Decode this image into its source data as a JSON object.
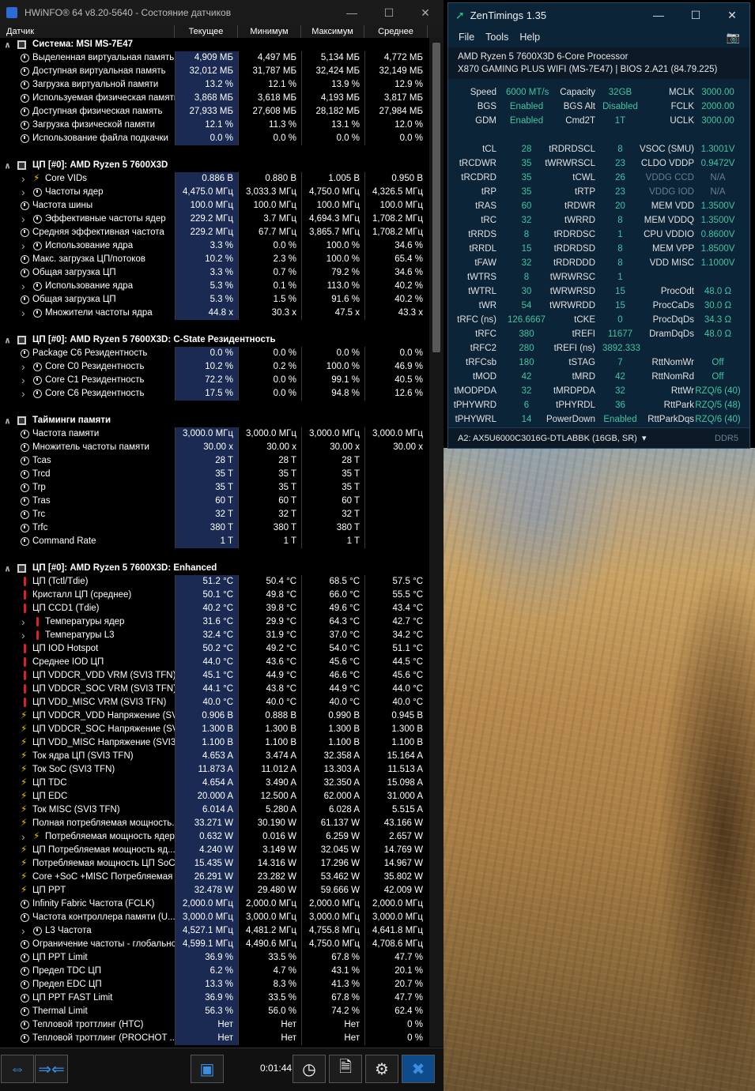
{
  "hwinfo": {
    "title": "HWiNFO® 64 v8.20-5640 - Состояние датчиков",
    "columns": [
      "Датчик",
      "Текущее",
      "Минимум",
      "Максимум",
      "Среднее"
    ],
    "rows": [
      {
        "t": "g",
        "n": "Система: MSI MS-7E47"
      },
      {
        "t": "r",
        "n": "Выделенная виртуальная память",
        "ic": "gauge",
        "v": [
          "4,909 МБ",
          "4,497 МБ",
          "5,134 МБ",
          "4,772 МБ"
        ]
      },
      {
        "t": "r",
        "n": "Доступная виртуальная память",
        "ic": "gauge",
        "v": [
          "32,012 МБ",
          "31,787 МБ",
          "32,424 МБ",
          "32,149 МБ"
        ]
      },
      {
        "t": "r",
        "n": "Загрузка виртуальной памяти",
        "ic": "gauge",
        "v": [
          "13.2 %",
          "12.1 %",
          "13.9 %",
          "12.9 %"
        ]
      },
      {
        "t": "r",
        "n": "Используемая физическая память",
        "ic": "gauge",
        "v": [
          "3,868 МБ",
          "3,618 МБ",
          "4,193 МБ",
          "3,817 МБ"
        ]
      },
      {
        "t": "r",
        "n": "Доступная физическая память",
        "ic": "gauge",
        "v": [
          "27,933 МБ",
          "27,608 МБ",
          "28,182 МБ",
          "27,984 МБ"
        ]
      },
      {
        "t": "r",
        "n": "Загрузка физической памяти",
        "ic": "gauge",
        "v": [
          "12.1 %",
          "11.3 %",
          "13.1 %",
          "12.0 %"
        ]
      },
      {
        "t": "r",
        "n": "Использование файла подкачки",
        "ic": "gauge",
        "v": [
          "0.0 %",
          "0.0 %",
          "0.0 %",
          "0.0 %"
        ]
      },
      {
        "t": "s"
      },
      {
        "t": "g",
        "n": "ЦП [#0]: AMD Ryzen 5 7600X3D"
      },
      {
        "t": "r",
        "n": "Core VIDs",
        "ic": "bolt",
        "sub": 1,
        "v": [
          "0.886 В",
          "0.880 В",
          "1.005 В",
          "0.950 В"
        ]
      },
      {
        "t": "r",
        "n": "Частоты ядер",
        "ic": "gauge",
        "sub": 1,
        "v": [
          "4,475.0 МГц",
          "3,033.3 МГц",
          "4,750.0 МГц",
          "4,326.5 МГц"
        ]
      },
      {
        "t": "r",
        "n": "Частота шины",
        "ic": "gauge",
        "v": [
          "100.0 МГц",
          "100.0 МГц",
          "100.0 МГц",
          "100.0 МГц"
        ]
      },
      {
        "t": "r",
        "n": "Эффективные частоты ядер",
        "ic": "gauge",
        "sub": 1,
        "v": [
          "229.2 МГц",
          "3.7 МГц",
          "4,694.3 МГц",
          "1,708.2 МГц"
        ]
      },
      {
        "t": "r",
        "n": "Средняя эффективная частота",
        "ic": "gauge",
        "v": [
          "229.2 МГц",
          "67.7 МГц",
          "3,865.7 МГц",
          "1,708.2 МГц"
        ]
      },
      {
        "t": "r",
        "n": "Использование ядра",
        "ic": "gauge",
        "sub": 1,
        "v": [
          "3.3 %",
          "0.0 %",
          "100.0 %",
          "34.6 %"
        ]
      },
      {
        "t": "r",
        "n": "Макс. загрузка ЦП/потоков",
        "ic": "gauge",
        "v": [
          "10.2 %",
          "2.3 %",
          "100.0 %",
          "65.4 %"
        ]
      },
      {
        "t": "r",
        "n": "Общая загрузка ЦП",
        "ic": "gauge",
        "v": [
          "3.3 %",
          "0.7 %",
          "79.2 %",
          "34.6 %"
        ]
      },
      {
        "t": "r",
        "n": "Использование ядра",
        "ic": "gauge",
        "sub": 1,
        "v": [
          "5.3 %",
          "0.1 %",
          "113.0 %",
          "40.2 %"
        ]
      },
      {
        "t": "r",
        "n": "Общая загрузка ЦП",
        "ic": "gauge",
        "v": [
          "5.3 %",
          "1.5 %",
          "91.6 %",
          "40.2 %"
        ]
      },
      {
        "t": "r",
        "n": "Множители частоты ядра",
        "ic": "gauge",
        "sub": 1,
        "v": [
          "44.8 x",
          "30.3 x",
          "47.5 x",
          "43.3 x"
        ]
      },
      {
        "t": "s"
      },
      {
        "t": "g",
        "n": "ЦП [#0]: AMD Ryzen 5 7600X3D: C-State Резидентность"
      },
      {
        "t": "r",
        "n": "Package C6 Резидентность",
        "ic": "gauge",
        "v": [
          "0.0 %",
          "0.0 %",
          "0.0 %",
          "0.0 %"
        ]
      },
      {
        "t": "r",
        "n": "Core C0 Резидентность",
        "ic": "gauge",
        "sub": 1,
        "v": [
          "10.2 %",
          "0.2 %",
          "100.0 %",
          "46.9 %"
        ]
      },
      {
        "t": "r",
        "n": "Core C1 Резидентность",
        "ic": "gauge",
        "sub": 1,
        "v": [
          "72.2 %",
          "0.0 %",
          "99.1 %",
          "40.5 %"
        ]
      },
      {
        "t": "r",
        "n": "Core C6 Резидентность",
        "ic": "gauge",
        "sub": 1,
        "v": [
          "17.5 %",
          "0.0 %",
          "94.8 %",
          "12.6 %"
        ]
      },
      {
        "t": "s"
      },
      {
        "t": "g",
        "n": "Тайминги памяти"
      },
      {
        "t": "r",
        "n": "Частота памяти",
        "ic": "gauge",
        "v": [
          "3,000.0 МГц",
          "3,000.0 МГц",
          "3,000.0 МГц",
          "3,000.0 МГц"
        ]
      },
      {
        "t": "r",
        "n": "Множитель частоты памяти",
        "ic": "gauge",
        "v": [
          "30.00 x",
          "30.00 x",
          "30.00 x",
          "30.00 x"
        ]
      },
      {
        "t": "r",
        "n": "Tcas",
        "ic": "gauge",
        "v": [
          "28 T",
          "28 T",
          "28 T",
          ""
        ]
      },
      {
        "t": "r",
        "n": "Trcd",
        "ic": "gauge",
        "v": [
          "35 T",
          "35 T",
          "35 T",
          ""
        ]
      },
      {
        "t": "r",
        "n": "Trp",
        "ic": "gauge",
        "v": [
          "35 T",
          "35 T",
          "35 T",
          ""
        ]
      },
      {
        "t": "r",
        "n": "Tras",
        "ic": "gauge",
        "v": [
          "60 T",
          "60 T",
          "60 T",
          ""
        ]
      },
      {
        "t": "r",
        "n": "Trc",
        "ic": "gauge",
        "v": [
          "32 T",
          "32 T",
          "32 T",
          ""
        ]
      },
      {
        "t": "r",
        "n": "Trfc",
        "ic": "gauge",
        "v": [
          "380 T",
          "380 T",
          "380 T",
          ""
        ]
      },
      {
        "t": "r",
        "n": "Command Rate",
        "ic": "gauge",
        "v": [
          "1 T",
          "1 T",
          "1 T",
          ""
        ]
      },
      {
        "t": "s"
      },
      {
        "t": "g",
        "n": "ЦП [#0]: AMD Ryzen 5 7600X3D: Enhanced"
      },
      {
        "t": "r",
        "n": "ЦП (Tctl/Tdie)",
        "ic": "th",
        "v": [
          "51.2 °C",
          "50.4 °C",
          "68.5 °C",
          "57.5 °C"
        ]
      },
      {
        "t": "r",
        "n": "Кристалл ЦП (среднее)",
        "ic": "th",
        "v": [
          "50.1 °C",
          "49.8 °C",
          "66.0 °C",
          "55.5 °C"
        ]
      },
      {
        "t": "r",
        "n": "ЦП CCD1 (Tdie)",
        "ic": "th",
        "v": [
          "40.2 °C",
          "39.8 °C",
          "49.6 °C",
          "43.4 °C"
        ]
      },
      {
        "t": "r",
        "n": "Температуры ядер",
        "ic": "th",
        "sub": 1,
        "v": [
          "31.6 °C",
          "29.9 °C",
          "64.3 °C",
          "42.7 °C"
        ]
      },
      {
        "t": "r",
        "n": "Температуры L3",
        "ic": "th",
        "sub": 1,
        "v": [
          "32.4 °C",
          "31.9 °C",
          "37.0 °C",
          "34.2 °C"
        ]
      },
      {
        "t": "r",
        "n": "ЦП IOD Hotspot",
        "ic": "th",
        "v": [
          "50.2 °C",
          "49.2 °C",
          "54.0 °C",
          "51.1 °C"
        ]
      },
      {
        "t": "r",
        "n": "Среднее IOD ЦП",
        "ic": "th",
        "v": [
          "44.0 °C",
          "43.6 °C",
          "45.6 °C",
          "44.5 °C"
        ]
      },
      {
        "t": "r",
        "n": "ЦП VDDCR_VDD VRM (SVI3 TFN)",
        "ic": "th",
        "v": [
          "45.1 °C",
          "44.9 °C",
          "46.6 °C",
          "45.6 °C"
        ]
      },
      {
        "t": "r",
        "n": "ЦП VDDCR_SOC VRM (SVI3 TFN)",
        "ic": "th",
        "v": [
          "44.1 °C",
          "43.8 °C",
          "44.9 °C",
          "44.0 °C"
        ]
      },
      {
        "t": "r",
        "n": "ЦП VDD_MISC VRM (SVI3 TFN)",
        "ic": "th",
        "v": [
          "40.0 °C",
          "40.0 °C",
          "40.0 °C",
          "40.0 °C"
        ]
      },
      {
        "t": "r",
        "n": "ЦП VDDCR_VDD Напряжение (SV...",
        "ic": "bolt",
        "v": [
          "0.906 В",
          "0.888 В",
          "0.990 В",
          "0.945 В"
        ]
      },
      {
        "t": "r",
        "n": "ЦП VDDCR_SOC Напряжение (SV...",
        "ic": "bolt",
        "v": [
          "1.300 В",
          "1.300 В",
          "1.300 В",
          "1.300 В"
        ]
      },
      {
        "t": "r",
        "n": "ЦП VDD_MISC Напряжение (SVI3...",
        "ic": "bolt",
        "v": [
          "1.100 В",
          "1.100 В",
          "1.100 В",
          "1.100 В"
        ]
      },
      {
        "t": "r",
        "n": "Ток ядра ЦП (SVI3 TFN)",
        "ic": "bolt",
        "v": [
          "4.653 A",
          "3.474 A",
          "32.358 A",
          "15.164 A"
        ]
      },
      {
        "t": "r",
        "n": "Ток SoC (SVI3 TFN)",
        "ic": "bolt",
        "v": [
          "11.873 A",
          "11.012 A",
          "13.303 A",
          "11.513 A"
        ]
      },
      {
        "t": "r",
        "n": "ЦП TDC",
        "ic": "bolt",
        "v": [
          "4.654 A",
          "3.490 A",
          "32.350 A",
          "15.098 A"
        ]
      },
      {
        "t": "r",
        "n": "ЦП EDC",
        "ic": "bolt",
        "v": [
          "20.000 A",
          "12.500 A",
          "62.000 A",
          "31.000 A"
        ]
      },
      {
        "t": "r",
        "n": "Ток MISC (SVI3 TFN)",
        "ic": "bolt",
        "v": [
          "6.014 A",
          "5.280 A",
          "6.028 A",
          "5.515 A"
        ]
      },
      {
        "t": "r",
        "n": "Полная потребляемая мощность...",
        "ic": "bolt",
        "v": [
          "33.271 W",
          "30.190 W",
          "61.137 W",
          "43.166 W"
        ]
      },
      {
        "t": "r",
        "n": "Потребляемая мощность ядер",
        "ic": "bolt",
        "sub": 1,
        "v": [
          "0.632 W",
          "0.016 W",
          "6.259 W",
          "2.657 W"
        ]
      },
      {
        "t": "r",
        "n": "ЦП Потребляемая мощность яд...",
        "ic": "bolt",
        "v": [
          "4.240 W",
          "3.149 W",
          "32.045 W",
          "14.769 W"
        ]
      },
      {
        "t": "r",
        "n": "Потребляемая мощность ЦП SoC",
        "ic": "bolt",
        "v": [
          "15.435 W",
          "14.316 W",
          "17.296 W",
          "14.967 W"
        ]
      },
      {
        "t": "r",
        "n": "Core +SoC +MISC Потребляемая ...",
        "ic": "bolt",
        "v": [
          "26.291 W",
          "23.282 W",
          "53.462 W",
          "35.802 W"
        ]
      },
      {
        "t": "r",
        "n": "ЦП PPT",
        "ic": "bolt",
        "v": [
          "32.478 W",
          "29.480 W",
          "59.666 W",
          "42.009 W"
        ]
      },
      {
        "t": "r",
        "n": "Infinity Fabric Частота (FCLK)",
        "ic": "gauge",
        "v": [
          "2,000.0 МГц",
          "2,000.0 МГц",
          "2,000.0 МГц",
          "2,000.0 МГц"
        ]
      },
      {
        "t": "r",
        "n": "Частота контроллера памяти (U...",
        "ic": "gauge",
        "v": [
          "3,000.0 МГц",
          "3,000.0 МГц",
          "3,000.0 МГц",
          "3,000.0 МГц"
        ]
      },
      {
        "t": "r",
        "n": "L3 Частота",
        "ic": "gauge",
        "sub": 1,
        "v": [
          "4,527.1 МГц",
          "4,481.2 МГц",
          "4,755.8 МГц",
          "4,641.8 МГц"
        ]
      },
      {
        "t": "r",
        "n": "Ограничение частоты - глобально",
        "ic": "gauge",
        "v": [
          "4,599.1 МГц",
          "4,490.6 МГц",
          "4,750.0 МГц",
          "4,708.6 МГц"
        ]
      },
      {
        "t": "r",
        "n": "ЦП PPT Limit",
        "ic": "gauge",
        "v": [
          "36.9 %",
          "33.5 %",
          "67.8 %",
          "47.7 %"
        ]
      },
      {
        "t": "r",
        "n": "Предел TDC ЦП",
        "ic": "gauge",
        "v": [
          "6.2 %",
          "4.7 %",
          "43.1 %",
          "20.1 %"
        ]
      },
      {
        "t": "r",
        "n": "Предел EDC ЦП",
        "ic": "gauge",
        "v": [
          "13.3 %",
          "8.3 %",
          "41.3 %",
          "20.7 %"
        ]
      },
      {
        "t": "r",
        "n": "ЦП PPT FAST Limit",
        "ic": "gauge",
        "v": [
          "36.9 %",
          "33.5 %",
          "67.8 %",
          "47.7 %"
        ]
      },
      {
        "t": "r",
        "n": "Thermal Limit",
        "ic": "gauge",
        "v": [
          "56.3 %",
          "56.0 %",
          "74.2 %",
          "62.4 %"
        ]
      },
      {
        "t": "r",
        "n": "Тепловой троттлинг (HTC)",
        "ic": "gauge",
        "v": [
          "Нет",
          "Нет",
          "Нет",
          "0 %"
        ]
      },
      {
        "t": "r",
        "n": "Тепловой троттлинг (PROCHOT ...",
        "ic": "gauge",
        "v": [
          "Нет",
          "Нет",
          "Нет",
          "0 %"
        ]
      }
    ],
    "timer": "0:01:44"
  },
  "zen": {
    "title": "ZenTimings 1.35",
    "menu": [
      "File",
      "Tools",
      "Help"
    ],
    "cpu": "AMD Ryzen 5 7600X3D 6-Core Processor",
    "board": "X870 GAMING PLUS WIFI (MS-7E47) | BIOS 2.A21 (84.79.225)",
    "grid": [
      [
        [
          "Speed",
          "6000 MT/s"
        ],
        [
          "Capacity",
          "32GB"
        ],
        [
          "MCLK",
          "3000.00"
        ]
      ],
      [
        [
          "BGS",
          "Enabled"
        ],
        [
          "BGS Alt",
          "Disabled"
        ],
        [
          "FCLK",
          "2000.00"
        ]
      ],
      [
        [
          "GDM",
          "Enabled"
        ],
        [
          "Cmd2T",
          "1T"
        ],
        [
          "UCLK",
          "3000.00"
        ]
      ],
      null,
      [
        [
          "tCL",
          "28"
        ],
        [
          "tRDRDSCL",
          "8"
        ],
        [
          "VSOC (SMU)",
          "1.3001V"
        ]
      ],
      [
        [
          "tRCDWR",
          "35"
        ],
        [
          "tWRWRSCL",
          "23"
        ],
        [
          "CLDO VDDP",
          "0.9472V"
        ]
      ],
      [
        [
          "tRCDRD",
          "35"
        ],
        [
          "tCWL",
          "26"
        ],
        [
          "VDDG CCD",
          "N/A",
          1
        ]
      ],
      [
        [
          "tRP",
          "35"
        ],
        [
          "tRTP",
          "23"
        ],
        [
          "VDDG IOD",
          "N/A",
          1
        ]
      ],
      [
        [
          "tRAS",
          "60"
        ],
        [
          "tRDWR",
          "20"
        ],
        [
          "MEM VDD",
          "1.3500V"
        ]
      ],
      [
        [
          "tRC",
          "32"
        ],
        [
          "tWRRD",
          "8"
        ],
        [
          "MEM VDDQ",
          "1.3500V"
        ]
      ],
      [
        [
          "tRRDS",
          "8"
        ],
        [
          "tRDRDSC",
          "1"
        ],
        [
          "CPU VDDIO",
          "0.8600V"
        ]
      ],
      [
        [
          "tRRDL",
          "15"
        ],
        [
          "tRDRDSD",
          "8"
        ],
        [
          "MEM VPP",
          "1.8500V"
        ]
      ],
      [
        [
          "tFAW",
          "32"
        ],
        [
          "tRDRDDD",
          "8"
        ],
        [
          "VDD MISC",
          "1.1000V"
        ]
      ],
      [
        [
          "tWTRS",
          "8"
        ],
        [
          "tWRWRSC",
          "1"
        ],
        null
      ],
      [
        [
          "tWTRL",
          "30"
        ],
        [
          "tWRWRSD",
          "15"
        ],
        [
          "ProcOdt",
          "48.0 Ω"
        ]
      ],
      [
        [
          "tWR",
          "54"
        ],
        [
          "tWRWRDD",
          "15"
        ],
        [
          "ProcCaDs",
          "30.0 Ω"
        ]
      ],
      [
        [
          "tRFC (ns)",
          "126.6667"
        ],
        [
          "tCKE",
          "0"
        ],
        [
          "ProcDqDs",
          "34.3 Ω"
        ]
      ],
      [
        [
          "tRFC",
          "380"
        ],
        [
          "tREFI",
          "11677"
        ],
        [
          "DramDqDs",
          "48.0 Ω"
        ]
      ],
      [
        [
          "tRFC2",
          "280"
        ],
        [
          "tREFI (ns)",
          "3892.333"
        ],
        null
      ],
      [
        [
          "tRFCsb",
          "180"
        ],
        [
          "tSTAG",
          "7"
        ],
        [
          "RttNomWr",
          "Off"
        ]
      ],
      [
        [
          "tMOD",
          "42"
        ],
        [
          "tMRD",
          "42"
        ],
        [
          "RttNomRd",
          "Off"
        ]
      ],
      [
        [
          "tMODPDA",
          "32"
        ],
        [
          "tMRDPDA",
          "32"
        ],
        [
          "RttWr",
          "RZQ/6 (40)"
        ]
      ],
      [
        [
          "tPHYWRD",
          "6"
        ],
        [
          "tPHYRDL",
          "36"
        ],
        [
          "RttPark",
          "RZQ/5 (48)"
        ]
      ],
      [
        [
          "tPHYWRL",
          "14"
        ],
        [
          "PowerDown",
          "Enabled"
        ],
        [
          "RttParkDqs",
          "RZQ/6 (40)"
        ]
      ]
    ],
    "module": "A2: AX5U6000C3016G-DTLABBK (16GB, SR)",
    "ddr": "DDR5"
  }
}
